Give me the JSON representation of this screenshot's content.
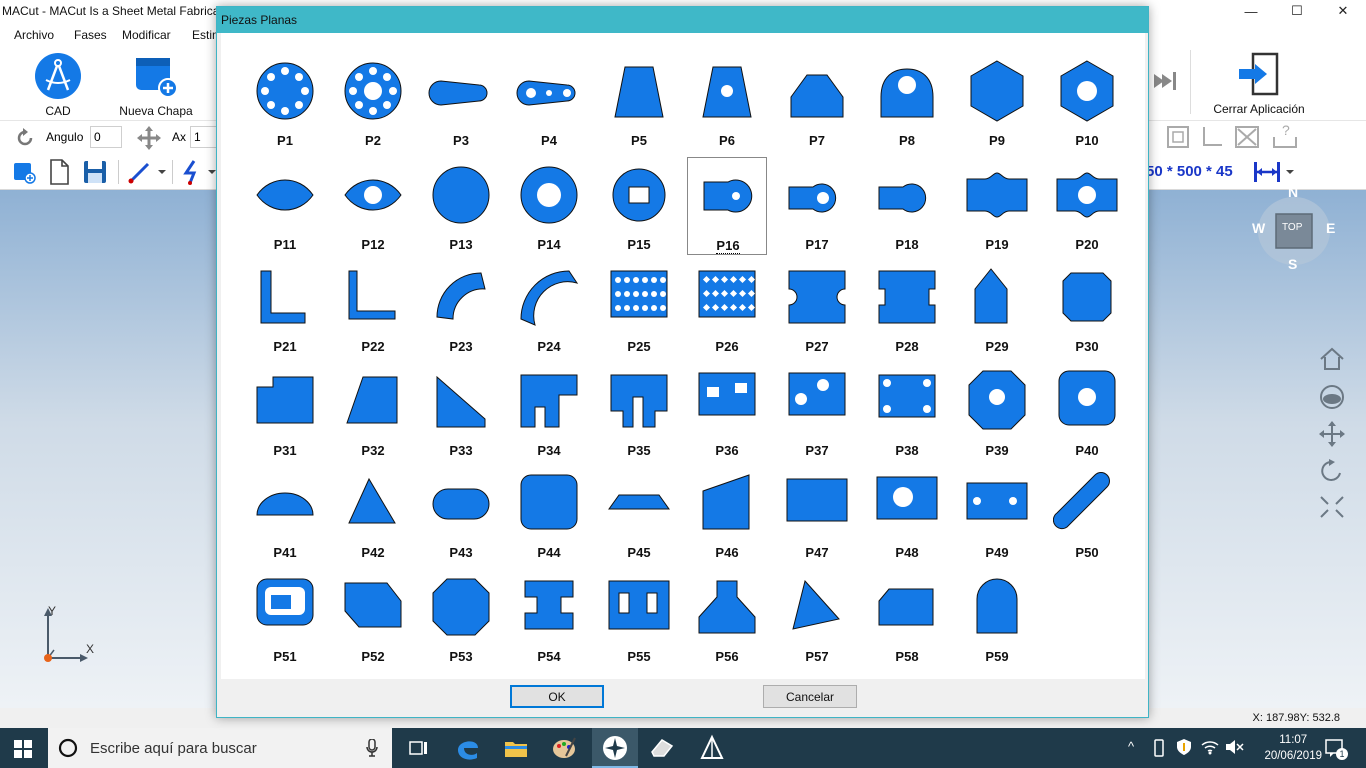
{
  "app": {
    "title": "MACut - MACut Is a Sheet Metal Fabrica",
    "window_controls": [
      "—",
      "☐",
      "✕"
    ]
  },
  "menu": [
    "Archivo",
    "Fases",
    "Modificar",
    "Estin"
  ],
  "ribbon": {
    "cad_label": "CAD",
    "new_sheet_label": "Nueva Chapa",
    "exit_label": "Cerrar Aplicación"
  },
  "toolbar": {
    "angle_label": "Angulo",
    "angle_value": "0",
    "ax_label": "Ax",
    "ax_value": "1",
    "dims_readout": "50 * 500 * 45"
  },
  "viewport": {
    "compass": {
      "n": "N",
      "s": "S",
      "e": "E",
      "w": "W",
      "top": "TOP"
    },
    "axis_y": "Y",
    "axis_x": "X"
  },
  "status": {
    "coords": "X: 187.98Y: 532.8"
  },
  "taskbar": {
    "search_placeholder": "Escribe aquí para buscar",
    "time": "11:07",
    "date": "20/06/2019",
    "notification_count": "1"
  },
  "dialog": {
    "title": "Piezas Planas",
    "ok_label": "OK",
    "cancel_label": "Cancelar",
    "selected": "P16",
    "pieces": [
      "P1",
      "P2",
      "P3",
      "P4",
      "P5",
      "P6",
      "P7",
      "P8",
      "P9",
      "P10",
      "P11",
      "P12",
      "P13",
      "P14",
      "P15",
      "P16",
      "P17",
      "P18",
      "P19",
      "P20",
      "P21",
      "P22",
      "P23",
      "P24",
      "P25",
      "P26",
      "P27",
      "P28",
      "P29",
      "P30",
      "P31",
      "P32",
      "P33",
      "P34",
      "P35",
      "P36",
      "P37",
      "P38",
      "P39",
      "P40",
      "P41",
      "P42",
      "P43",
      "P44",
      "P45",
      "P46",
      "P47",
      "P48",
      "P49",
      "P50",
      "P51",
      "P52",
      "P53",
      "P54",
      "P55",
      "P56",
      "P57",
      "P58",
      "P59"
    ]
  },
  "colors": {
    "piece_fill": "#1479e6",
    "dialog_title": "#3fb8c8",
    "accent": "#1a37c8"
  }
}
